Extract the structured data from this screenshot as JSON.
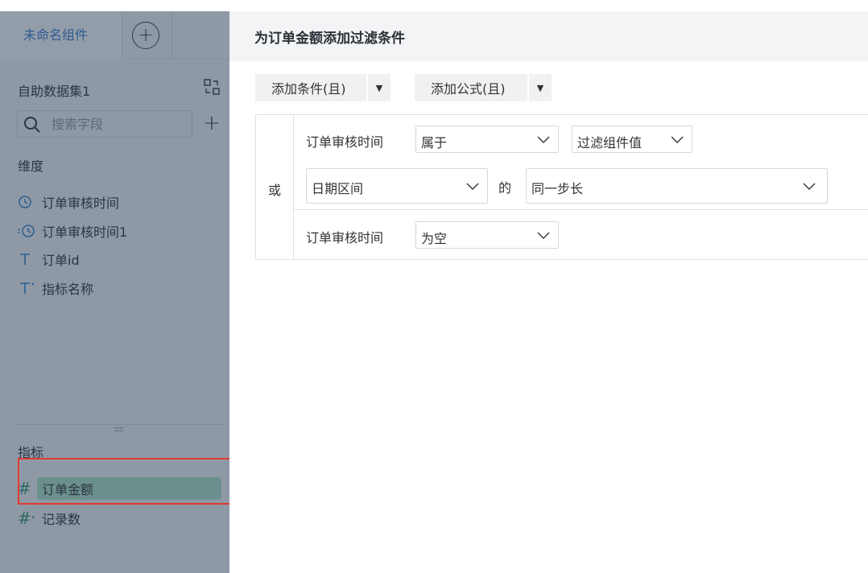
{
  "sidebar": {
    "tab_name": "未命名组件",
    "tab_add_symbol": "+",
    "dataset_name": "自助数据集1",
    "search_placeholder": "搜索字段",
    "add_symbol": "+",
    "dimension_title": "维度",
    "dimensions": [
      {
        "label": "订单审核时间",
        "icon": "clock-icon"
      },
      {
        "label": "订单审核时间1",
        "icon": "derived-clock-icon"
      },
      {
        "label": "订单id",
        "icon": "text-type-icon"
      },
      {
        "label": "指标名称",
        "icon": "text-derived-type-icon"
      }
    ],
    "grip": "::::: ",
    "measure_title": "指标",
    "measures": [
      {
        "label": "订单金额",
        "icon": "hash-icon",
        "symbol": "#",
        "selected": true
      },
      {
        "label": "记录数",
        "icon": "hash-derived-icon",
        "symbol": "#",
        "selected": false
      }
    ]
  },
  "panel": {
    "title": "为订单金额添加过滤条件",
    "add_condition_label": "添加条件(且)",
    "add_formula_label": "添加公式(且)",
    "dropdown_arrow": "▼",
    "or_label": "或",
    "condition1": {
      "field": "订单审核时间",
      "operator": "属于",
      "value_type": "过滤组件值",
      "sub_type": "日期区间",
      "de": "的",
      "step": "同一步长"
    },
    "condition2": {
      "field": "订单审核时间",
      "operator": "为空"
    }
  },
  "colors": {
    "sidebar_overlay": "#8f99a6",
    "highlight_border": "#e03a2f",
    "selected_measure": "#6b8f8c",
    "header_bg": "#f3f4f6"
  }
}
